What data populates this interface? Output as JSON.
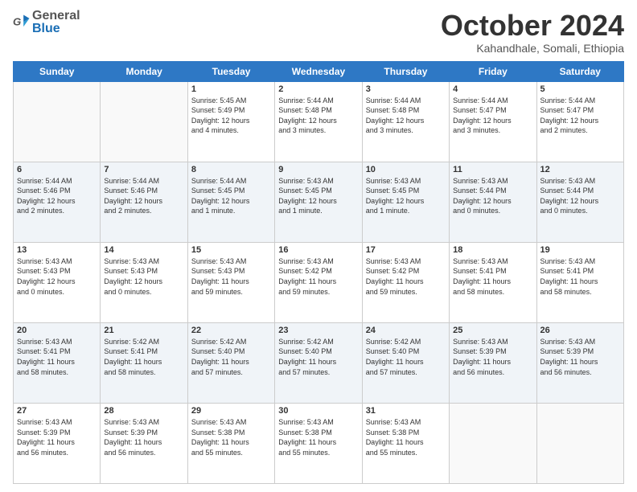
{
  "header": {
    "logo": {
      "general": "General",
      "blue": "Blue",
      "icon": "▶"
    },
    "title": "October 2024",
    "location": "Kahandhale, Somali, Ethiopia"
  },
  "days_of_week": [
    "Sunday",
    "Monday",
    "Tuesday",
    "Wednesday",
    "Thursday",
    "Friday",
    "Saturday"
  ],
  "weeks": [
    [
      {
        "day": "",
        "info": ""
      },
      {
        "day": "",
        "info": ""
      },
      {
        "day": "1",
        "info": "Sunrise: 5:45 AM\nSunset: 5:49 PM\nDaylight: 12 hours\nand 4 minutes."
      },
      {
        "day": "2",
        "info": "Sunrise: 5:44 AM\nSunset: 5:48 PM\nDaylight: 12 hours\nand 3 minutes."
      },
      {
        "day": "3",
        "info": "Sunrise: 5:44 AM\nSunset: 5:48 PM\nDaylight: 12 hours\nand 3 minutes."
      },
      {
        "day": "4",
        "info": "Sunrise: 5:44 AM\nSunset: 5:47 PM\nDaylight: 12 hours\nand 3 minutes."
      },
      {
        "day": "5",
        "info": "Sunrise: 5:44 AM\nSunset: 5:47 PM\nDaylight: 12 hours\nand 2 minutes."
      }
    ],
    [
      {
        "day": "6",
        "info": "Sunrise: 5:44 AM\nSunset: 5:46 PM\nDaylight: 12 hours\nand 2 minutes."
      },
      {
        "day": "7",
        "info": "Sunrise: 5:44 AM\nSunset: 5:46 PM\nDaylight: 12 hours\nand 2 minutes."
      },
      {
        "day": "8",
        "info": "Sunrise: 5:44 AM\nSunset: 5:45 PM\nDaylight: 12 hours\nand 1 minute."
      },
      {
        "day": "9",
        "info": "Sunrise: 5:43 AM\nSunset: 5:45 PM\nDaylight: 12 hours\nand 1 minute."
      },
      {
        "day": "10",
        "info": "Sunrise: 5:43 AM\nSunset: 5:45 PM\nDaylight: 12 hours\nand 1 minute."
      },
      {
        "day": "11",
        "info": "Sunrise: 5:43 AM\nSunset: 5:44 PM\nDaylight: 12 hours\nand 0 minutes."
      },
      {
        "day": "12",
        "info": "Sunrise: 5:43 AM\nSunset: 5:44 PM\nDaylight: 12 hours\nand 0 minutes."
      }
    ],
    [
      {
        "day": "13",
        "info": "Sunrise: 5:43 AM\nSunset: 5:43 PM\nDaylight: 12 hours\nand 0 minutes."
      },
      {
        "day": "14",
        "info": "Sunrise: 5:43 AM\nSunset: 5:43 PM\nDaylight: 12 hours\nand 0 minutes."
      },
      {
        "day": "15",
        "info": "Sunrise: 5:43 AM\nSunset: 5:43 PM\nDaylight: 11 hours\nand 59 minutes."
      },
      {
        "day": "16",
        "info": "Sunrise: 5:43 AM\nSunset: 5:42 PM\nDaylight: 11 hours\nand 59 minutes."
      },
      {
        "day": "17",
        "info": "Sunrise: 5:43 AM\nSunset: 5:42 PM\nDaylight: 11 hours\nand 59 minutes."
      },
      {
        "day": "18",
        "info": "Sunrise: 5:43 AM\nSunset: 5:41 PM\nDaylight: 11 hours\nand 58 minutes."
      },
      {
        "day": "19",
        "info": "Sunrise: 5:43 AM\nSunset: 5:41 PM\nDaylight: 11 hours\nand 58 minutes."
      }
    ],
    [
      {
        "day": "20",
        "info": "Sunrise: 5:43 AM\nSunset: 5:41 PM\nDaylight: 11 hours\nand 58 minutes."
      },
      {
        "day": "21",
        "info": "Sunrise: 5:42 AM\nSunset: 5:41 PM\nDaylight: 11 hours\nand 58 minutes."
      },
      {
        "day": "22",
        "info": "Sunrise: 5:42 AM\nSunset: 5:40 PM\nDaylight: 11 hours\nand 57 minutes."
      },
      {
        "day": "23",
        "info": "Sunrise: 5:42 AM\nSunset: 5:40 PM\nDaylight: 11 hours\nand 57 minutes."
      },
      {
        "day": "24",
        "info": "Sunrise: 5:42 AM\nSunset: 5:40 PM\nDaylight: 11 hours\nand 57 minutes."
      },
      {
        "day": "25",
        "info": "Sunrise: 5:43 AM\nSunset: 5:39 PM\nDaylight: 11 hours\nand 56 minutes."
      },
      {
        "day": "26",
        "info": "Sunrise: 5:43 AM\nSunset: 5:39 PM\nDaylight: 11 hours\nand 56 minutes."
      }
    ],
    [
      {
        "day": "27",
        "info": "Sunrise: 5:43 AM\nSunset: 5:39 PM\nDaylight: 11 hours\nand 56 minutes."
      },
      {
        "day": "28",
        "info": "Sunrise: 5:43 AM\nSunset: 5:39 PM\nDaylight: 11 hours\nand 56 minutes."
      },
      {
        "day": "29",
        "info": "Sunrise: 5:43 AM\nSunset: 5:38 PM\nDaylight: 11 hours\nand 55 minutes."
      },
      {
        "day": "30",
        "info": "Sunrise: 5:43 AM\nSunset: 5:38 PM\nDaylight: 11 hours\nand 55 minutes."
      },
      {
        "day": "31",
        "info": "Sunrise: 5:43 AM\nSunset: 5:38 PM\nDaylight: 11 hours\nand 55 minutes."
      },
      {
        "day": "",
        "info": ""
      },
      {
        "day": "",
        "info": ""
      }
    ]
  ]
}
